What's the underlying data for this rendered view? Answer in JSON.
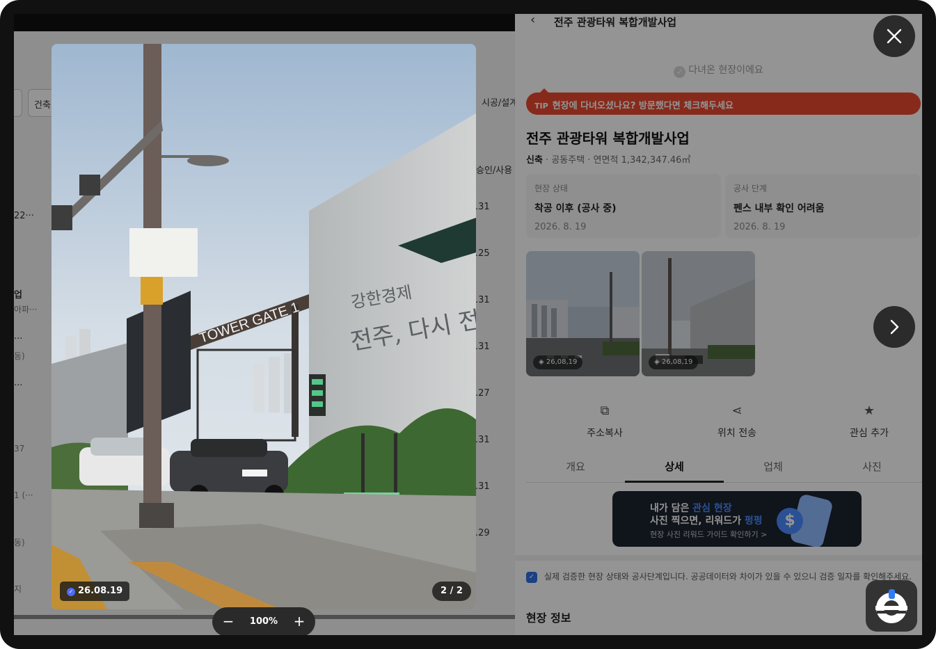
{
  "background_page": {
    "chips": [
      "",
      "건축",
      "시공/설계"
    ],
    "column_header": "승인/사용",
    "left_fragments": [
      "22···",
      "업",
      "아파···",
      "···",
      "동)",
      "···",
      "37",
      "1 (···",
      "동)",
      "지"
    ],
    "dates": [
      ".31",
      ".25",
      ".31",
      ".31",
      ".27",
      ".31",
      ".31",
      ".29"
    ]
  },
  "panel": {
    "header_title": "전주 관광타워 복합개발사업",
    "visited_label": "다녀온 현장이에요",
    "tip": {
      "badge": "TIP",
      "text": "현장에 다녀오셨나요? 방문했다면 체크해두세요"
    },
    "title": "전주 관광타워 복합개발사업",
    "meta": {
      "type": "신축",
      "rest": " · 공동주택 · 연면적 1,342,347.46㎡"
    },
    "stats": [
      {
        "label": "현장 상태",
        "value": "착공 이후 (공사 중)",
        "date": "2026. 8. 19"
      },
      {
        "label": "공사 단계",
        "value": "펜스 내부 확인 어려움",
        "date": "2026. 8. 19"
      }
    ],
    "thumbnails": [
      {
        "badge": "26,08,19"
      },
      {
        "badge": "26,08,19"
      }
    ],
    "actions": [
      {
        "label": "주소복사",
        "icon": "copy-icon"
      },
      {
        "label": "위치 전송",
        "icon": "share-icon"
      },
      {
        "label": "관심 추가",
        "icon": "star-icon"
      }
    ],
    "tabs": [
      "개요",
      "상세",
      "업체",
      "사진"
    ],
    "active_tab": "상세",
    "banner": {
      "line1_a": "내가 담은 ",
      "line1_b": "관심 현장",
      "line2_a": "사진 찍으면, 리워드가 ",
      "line2_b": "펑펑",
      "line3": "현장 사진 리워드 가이드 확인하기 >"
    },
    "notice": "실제 검증한 현장 상태와 공사단계입니다. 공공데이터와 차이가 있을 수 있으니 검증 일자를 확인해주세요.",
    "info_title": "현장 정보"
  },
  "viewer": {
    "date_badge": "26.08.19",
    "counter": "2 / 2",
    "zoom_out": "−",
    "zoom_level": "100%",
    "zoom_in": "+",
    "photo_texts": {
      "gate_sign": "TOWER GATE 1",
      "wall_line1": "강한경제",
      "wall_line2": "전주, 다시 전"
    }
  },
  "colors": {
    "tip_bg": "#e8492f",
    "accent_blue": "#4a8cff",
    "dark_button": "#2b2b2b"
  }
}
